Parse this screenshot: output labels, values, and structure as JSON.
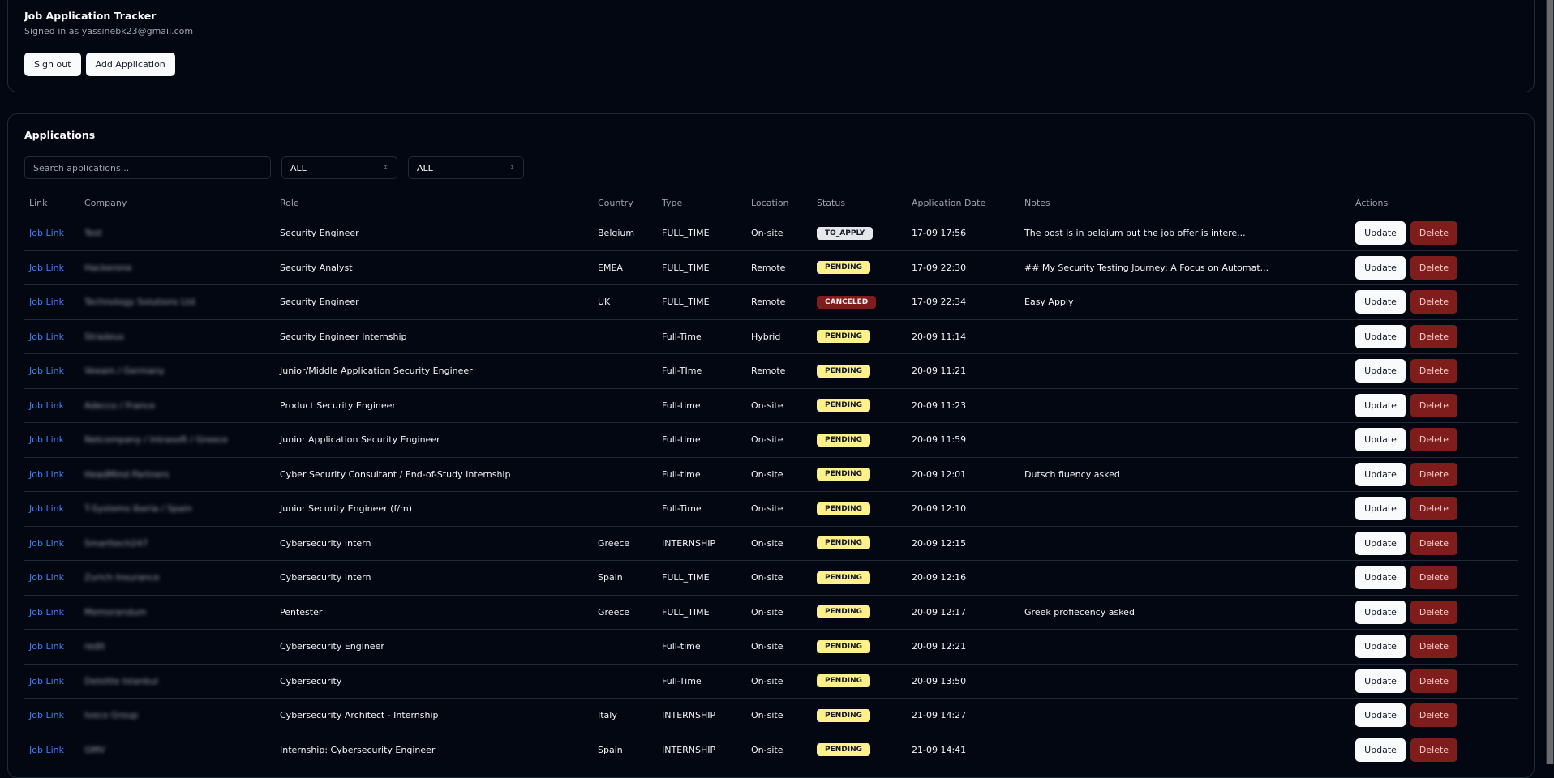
{
  "header": {
    "title": "Job Application Tracker",
    "signed_in": "Signed in as yassinebk23@gmail.com",
    "sign_out_label": "Sign out",
    "add_label": "Add Application"
  },
  "applications": {
    "title": "Applications",
    "search_placeholder": "Search applications...",
    "filter1": "ALL",
    "filter2": "ALL",
    "columns": [
      "Link",
      "Company",
      "Role",
      "Country",
      "Type",
      "Location",
      "Status",
      "Application Date",
      "Notes",
      "Actions"
    ],
    "update_label": "Update",
    "delete_label": "Delete",
    "rows": [
      {
        "link": "Job Link",
        "company": "Test",
        "role": "Security Engineer",
        "country": "Belgium",
        "type": "FULL_TIME",
        "location": "On-site",
        "status": "TO_APPLY",
        "date": "17-09 17:56",
        "notes": "The post is in belgium but the job offer is intere..."
      },
      {
        "link": "Job Link",
        "company": "Hackerone",
        "role": "Security Analyst",
        "country": "EMEA",
        "type": "FULL_TIME",
        "location": "Remote",
        "status": "PENDING",
        "date": "17-09 22:30",
        "notes": "## My Security Testing Journey: A Focus on Automat..."
      },
      {
        "link": "Job Link",
        "company": "Technology Solutions Ltd",
        "role": "Security Engineer",
        "country": "UK",
        "type": "FULL_TIME",
        "location": "Remote",
        "status": "CANCELED",
        "date": "17-09 22:34",
        "notes": "Easy Apply"
      },
      {
        "link": "Job Link",
        "company": "Stradeus",
        "role": "Security Engineer Internship",
        "country": "",
        "type": "Full-Time",
        "location": "Hybrid",
        "status": "PENDING",
        "date": "20-09 11:14",
        "notes": ""
      },
      {
        "link": "Job Link",
        "company": "Veeam / Germany",
        "role": "Junior/Middle Application Security Engineer",
        "country": "",
        "type": "Full-TIme",
        "location": "Remote",
        "status": "PENDING",
        "date": "20-09 11:21",
        "notes": ""
      },
      {
        "link": "Job Link",
        "company": "Adecco / France",
        "role": "Product Security Engineer",
        "country": "",
        "type": "Full-time",
        "location": "On-site",
        "status": "PENDING",
        "date": "20-09 11:23",
        "notes": ""
      },
      {
        "link": "Job Link",
        "company": "Netcompany / Intrasoft / Greece",
        "role": "Junior Application Security Engineer",
        "country": "",
        "type": "Full-time",
        "location": "On-site",
        "status": "PENDING",
        "date": "20-09 11:59",
        "notes": ""
      },
      {
        "link": "Job Link",
        "company": "HeadMind Partners",
        "role": "Cyber Security Consultant / End-of-Study Internship",
        "country": "",
        "type": "Full-time",
        "location": "On-site",
        "status": "PENDING",
        "date": "20-09 12:01",
        "notes": "Dutsch fluency asked"
      },
      {
        "link": "Job Link",
        "company": "T-Systems Iberia / Spain",
        "role": "Junior Security Engineer (f/m)",
        "country": "",
        "type": "Full-Time",
        "location": "On-site",
        "status": "PENDING",
        "date": "20-09 12:10",
        "notes": ""
      },
      {
        "link": "Job Link",
        "company": "Smarttech247",
        "role": "Cybersecurity Intern",
        "country": "Greece",
        "type": "INTERNSHIP",
        "location": "On-site",
        "status": "PENDING",
        "date": "20-09 12:15",
        "notes": ""
      },
      {
        "link": "Job Link",
        "company": "Zurich Insurance",
        "role": "Cybersecurity Intern",
        "country": "Spain",
        "type": "FULL_TIME",
        "location": "On-site",
        "status": "PENDING",
        "date": "20-09 12:16",
        "notes": ""
      },
      {
        "link": "Job Link",
        "company": "Memorandum",
        "role": "Pentester",
        "country": "Greece",
        "type": "FULL_TIME",
        "location": "On-site",
        "status": "PENDING",
        "date": "20-09 12:17",
        "notes": "Greek profiecency asked"
      },
      {
        "link": "Job Link",
        "company": "redit",
        "role": "Cybersecurity Engineer",
        "country": "",
        "type": "Full-time",
        "location": "On-site",
        "status": "PENDING",
        "date": "20-09 12:21",
        "notes": ""
      },
      {
        "link": "Job Link",
        "company": "Deloitte Istanbul",
        "role": "Cybersecurity",
        "country": "",
        "type": "Full-Time",
        "location": "On-site",
        "status": "PENDING",
        "date": "20-09 13:50",
        "notes": ""
      },
      {
        "link": "Job Link",
        "company": "Iveco Group",
        "role": "Cybersecurity Architect - Internship",
        "country": "Italy",
        "type": "INTERNSHIP",
        "location": "On-site",
        "status": "PENDING",
        "date": "21-09 14:27",
        "notes": ""
      },
      {
        "link": "Job Link",
        "company": "GMV",
        "role": "Internship: Cybersecurity Engineer",
        "country": "Spain",
        "type": "INTERNSHIP",
        "location": "On-site",
        "status": "PENDING",
        "date": "21-09 14:41",
        "notes": ""
      }
    ]
  },
  "colors": {
    "background": "#030712",
    "link": "#3b82f6",
    "pending": "#fef08a",
    "canceled": "#7f1d1d",
    "to_apply": "#e5e7eb",
    "delete": "#7f1d1d"
  }
}
